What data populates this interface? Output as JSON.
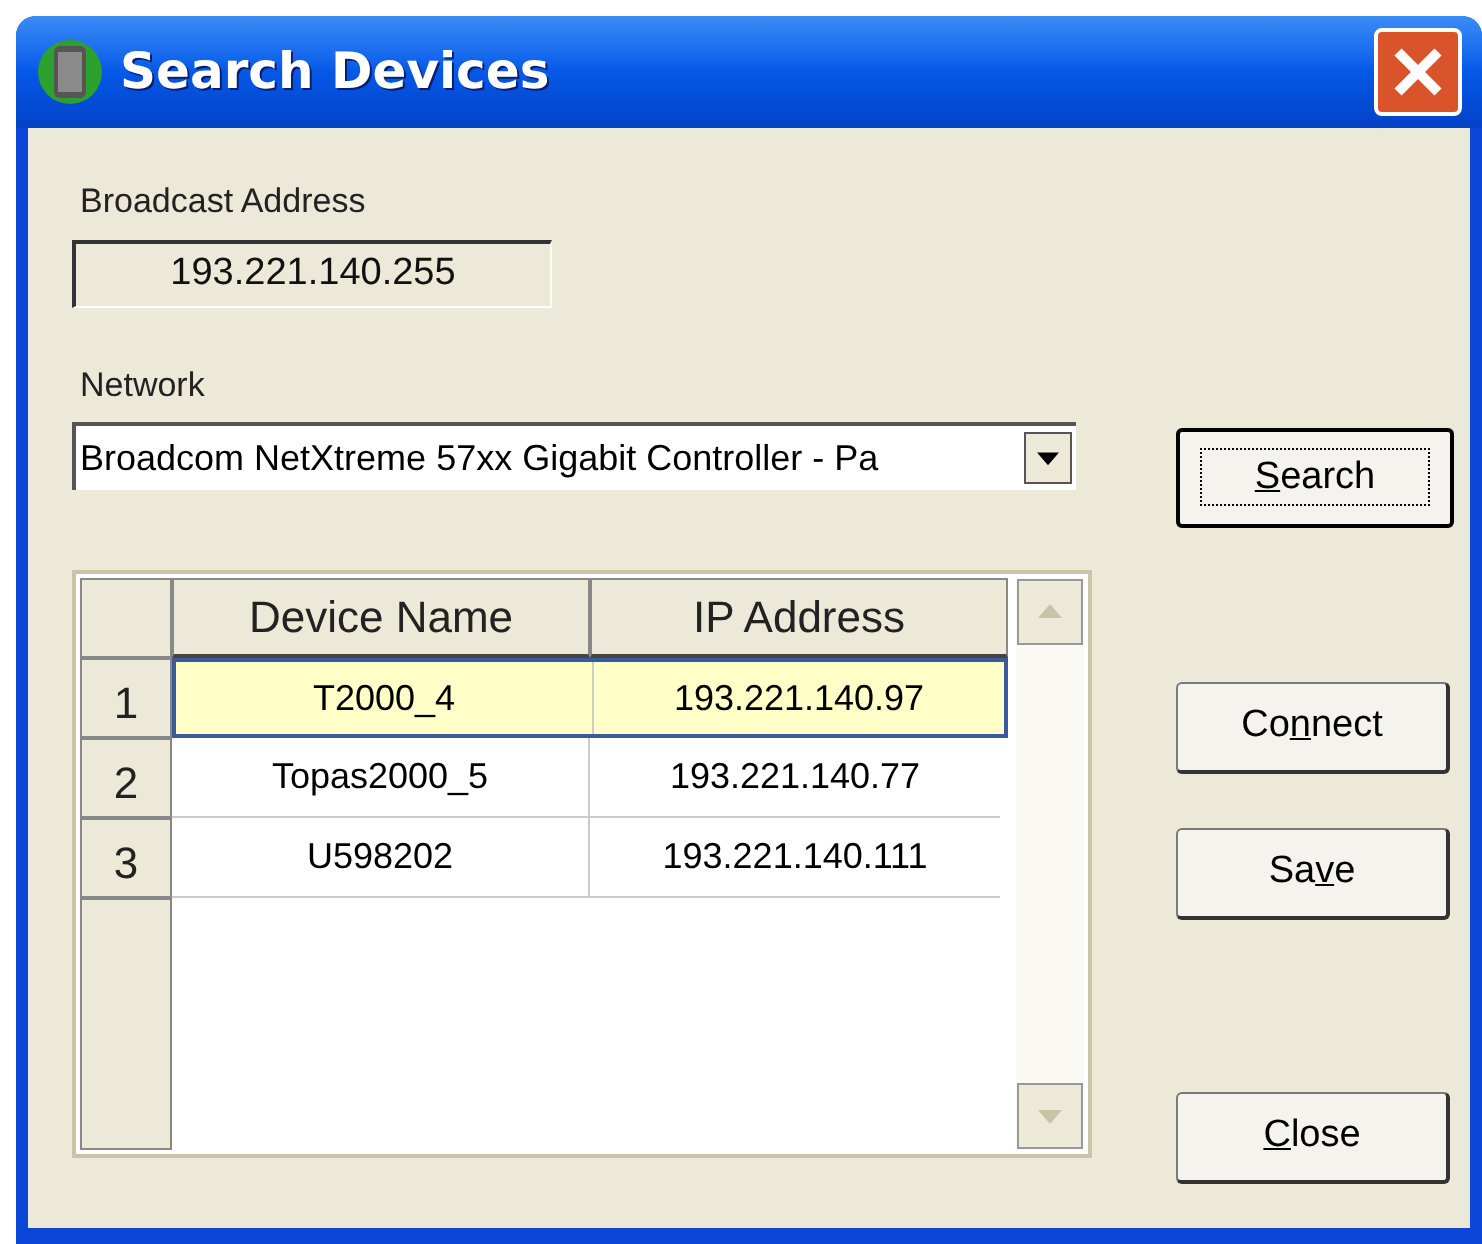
{
  "window": {
    "title": "Search Devices"
  },
  "broadcast": {
    "label": "Broadcast Address",
    "value": "193.221.140.255"
  },
  "network": {
    "label": "Network",
    "value": "Broadcom NetXtreme 57xx Gigabit Controller - Pa"
  },
  "table": {
    "columns": [
      "Device Name",
      "IP Address"
    ],
    "rows": [
      {
        "index": "1",
        "name": "T2000_4",
        "ip": "193.221.140.97",
        "selected": true
      },
      {
        "index": "2",
        "name": "Topas2000_5",
        "ip": "193.221.140.77",
        "selected": false
      },
      {
        "index": "3",
        "name": "U598202",
        "ip": "193.221.140.111",
        "selected": false
      }
    ]
  },
  "buttons": [
    {
      "key": "S",
      "post": "earch",
      "default": true
    },
    {
      "pre": "Co",
      "key": "n",
      "post": "nect",
      "default": false
    },
    {
      "pre": "Sa",
      "key": "v",
      "post": "e",
      "default": false
    },
    {
      "key": "C",
      "post": "lose",
      "default": false
    }
  ]
}
